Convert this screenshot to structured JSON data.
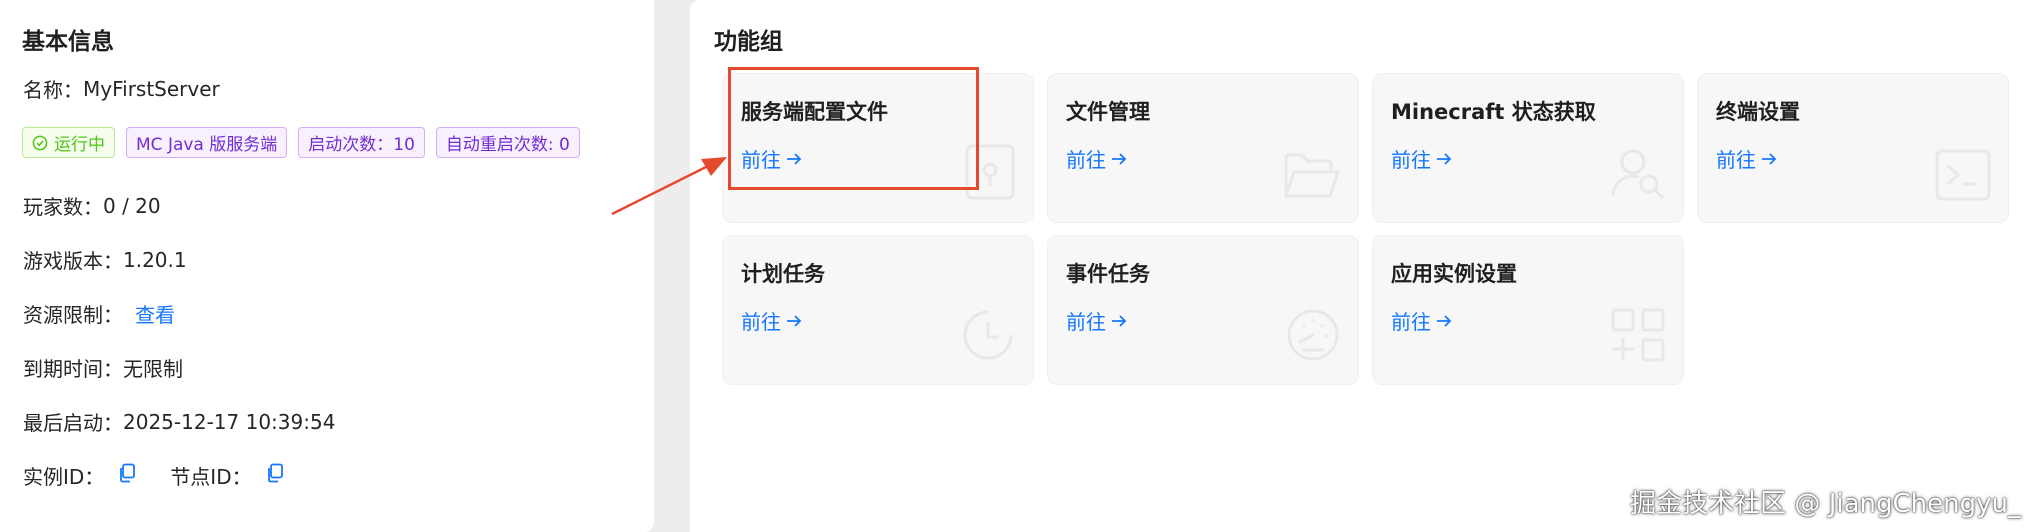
{
  "basic_info": {
    "title": "基本信息",
    "name_label": "名称：",
    "name_value": "MyFirstServer",
    "tags": [
      "运行中",
      "MC Java 版服务端",
      "启动次数：10",
      "自动重启次数: 0"
    ],
    "players_label": "玩家数：",
    "players_value": "0 / 20",
    "version_label": "游戏版本：",
    "version_value": "1.20.1",
    "resource_label": "资源限制：",
    "resource_link": "查看",
    "expire_label": "到期时间：",
    "expire_value": "无限制",
    "last_start_label": "最后启动：",
    "last_start_value": "2025-12-17 10:39:54",
    "instance_id_label": "实例ID：",
    "node_id_label": "节点ID："
  },
  "function_group": {
    "title": "功能组",
    "go_label": "前往",
    "cards": [
      {
        "title": "服务端配置文件",
        "icon": "file-settings-icon"
      },
      {
        "title": "文件管理",
        "icon": "folder-open-icon"
      },
      {
        "title": "Minecraft 状态获取",
        "icon": "user-search-icon"
      },
      {
        "title": "终端设置",
        "icon": "terminal-icon"
      },
      {
        "title": "计划任务",
        "icon": "clock-icon"
      },
      {
        "title": "事件任务",
        "icon": "dashboard-icon"
      },
      {
        "title": "应用实例设置",
        "icon": "app-add-icon"
      }
    ]
  },
  "watermark": "掘金技术社区 @ JiangChengyu_",
  "colors": {
    "accent": "#1677ff",
    "highlight": "#e64a2e",
    "success": "#52c41a",
    "purple": "#722ed1"
  }
}
